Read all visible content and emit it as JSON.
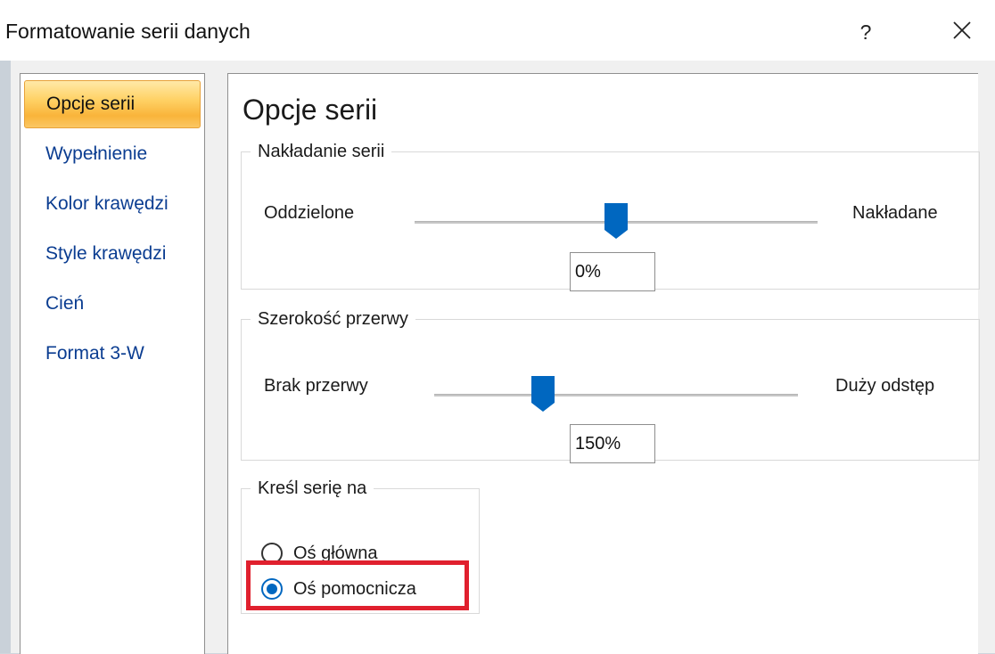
{
  "window": {
    "title": "Formatowanie serii danych",
    "help_glyph": "?",
    "close_icon": "close-icon"
  },
  "nav": {
    "items": [
      {
        "label": "Opcje serii",
        "active": true
      },
      {
        "label": "Wypełnienie",
        "active": false
      },
      {
        "label": "Kolor krawędzi",
        "active": false
      },
      {
        "label": "Style krawędzi",
        "active": false
      },
      {
        "label": "Cień",
        "active": false
      },
      {
        "label": "Format 3-W",
        "active": false
      }
    ]
  },
  "content": {
    "title": "Opcje serii",
    "overlap": {
      "legend": "Nakładanie serii",
      "left_label": "Oddzielone",
      "right_label": "Nakładane",
      "value": "0%",
      "slider_fraction": 0.5
    },
    "gap": {
      "legend": "Szerokość przerwy",
      "left_label": "Brak przerwy",
      "right_label": "Duży odstęp",
      "value": "150%",
      "slider_fraction": 0.3
    },
    "axis": {
      "legend": "Kreśl serię na",
      "options": [
        {
          "label": "Oś główna",
          "checked": false
        },
        {
          "label": "Oś pomocnicza",
          "checked": true
        }
      ]
    }
  },
  "colors": {
    "accent": "#0067c0",
    "nav_active": "#f9b43a",
    "highlight": "#e0202e",
    "nav_text": "#0b3d91"
  }
}
